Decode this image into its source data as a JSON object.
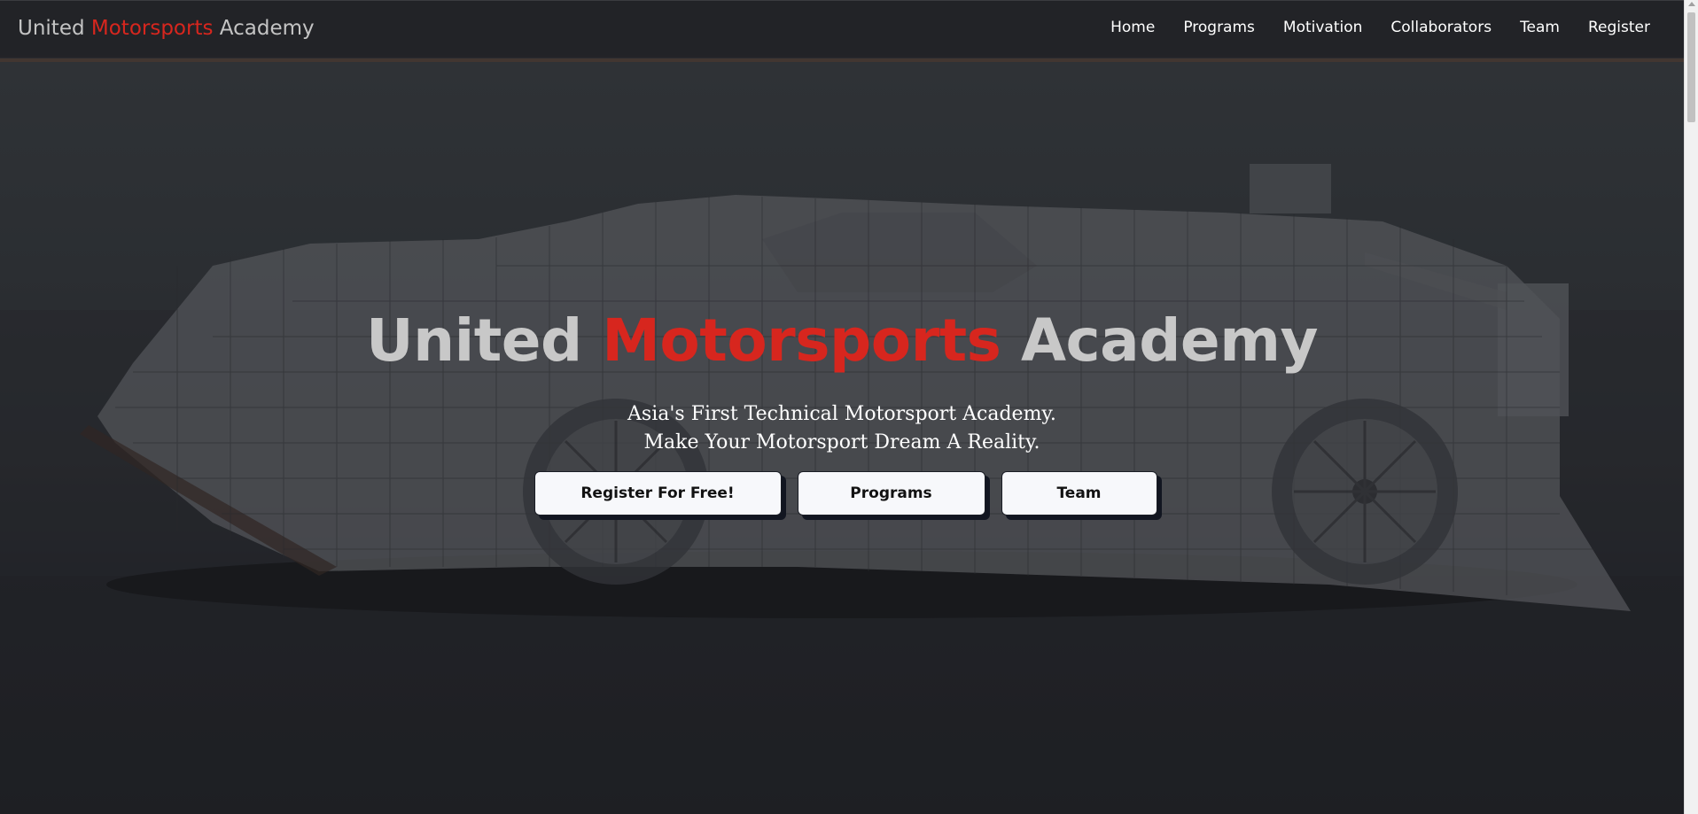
{
  "brand": {
    "part1": "United",
    "part2": "Motorsports",
    "part3": "Academy"
  },
  "nav": {
    "items": [
      {
        "label": "Home"
      },
      {
        "label": "Programs"
      },
      {
        "label": "Motivation"
      },
      {
        "label": "Collaborators"
      },
      {
        "label": "Team"
      },
      {
        "label": "Register"
      }
    ]
  },
  "hero": {
    "title_part1": "United",
    "title_part2": "Motorsports",
    "title_part3": "Academy",
    "subtitle_line1": "Asia's First Technical Motorsport Academy.",
    "subtitle_line2": "Make Your Motorsport Dream A Reality.",
    "buttons": {
      "register": "Register For Free!",
      "programs": "Programs",
      "team": "Team"
    }
  },
  "colors": {
    "accent": "#d7261e",
    "nav_bg": "#222327",
    "button_bg": "#f7f8fb"
  }
}
